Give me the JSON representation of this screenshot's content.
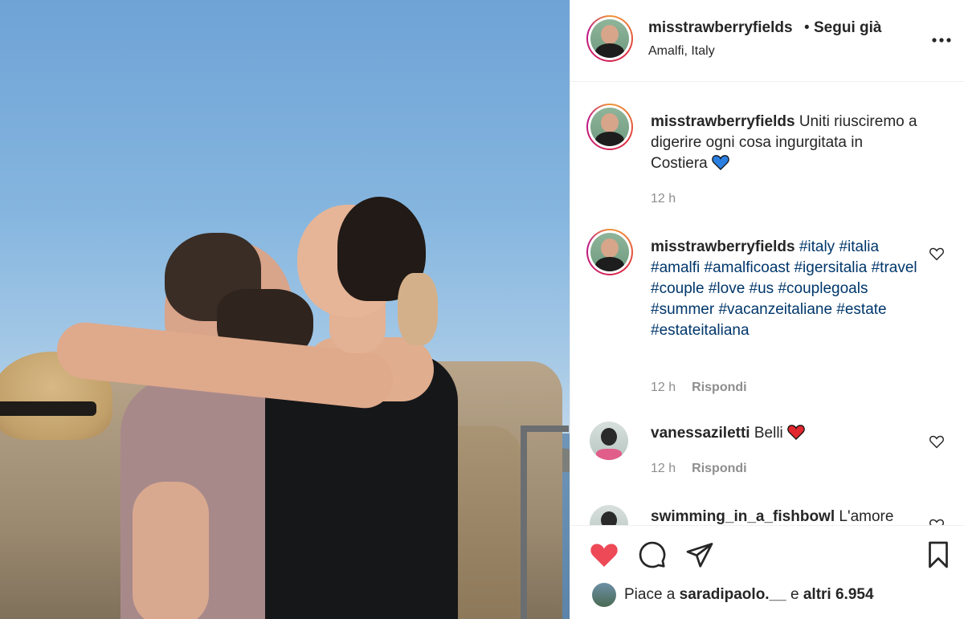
{
  "post": {
    "author": "misstrawberryfields",
    "separator": "•",
    "follow_status": "Segui già",
    "location": "Amalfi, Italy"
  },
  "caption": {
    "user": "misstrawberryfields",
    "text": "Uniti riusciremo a digerire ogni cosa ingurgitata in Costiera",
    "emoji": "blue-heart-emoji",
    "time": "12 h"
  },
  "comments": [
    {
      "user": "misstrawberryfields",
      "hashtags": [
        "#italy",
        "#italia",
        "#amalfi",
        "#amalficoast",
        "#igersitalia",
        "#travel",
        "#couple",
        "#love",
        "#us",
        "#couplegoals",
        "#summer",
        "#vacanzeitaliane",
        "#estate",
        "#estateitaliana"
      ],
      "time": "12 h",
      "reply_label": "Rispondi"
    },
    {
      "user": "vanessaziletti",
      "text": "Belli",
      "emoji": "red-heart-emoji",
      "time": "12 h",
      "reply_label": "Rispondi"
    },
    {
      "user": "swimming_in_a_fishbowl",
      "text": "L'amore"
    }
  ],
  "likes": {
    "prefix": "Piace a",
    "user": "saradipaolo.__",
    "middle": "e",
    "others": "altri 6.954"
  },
  "colors": {
    "like_red": "#ed4956",
    "hashtag_blue": "#00376b",
    "meta_grey": "#8e8e8e",
    "emoji_blue": "#2a7fe0"
  },
  "icons": [
    "more-options-icon",
    "heart-outline-icon",
    "heart-filled-icon",
    "comment-icon",
    "share-icon",
    "bookmark-icon"
  ]
}
